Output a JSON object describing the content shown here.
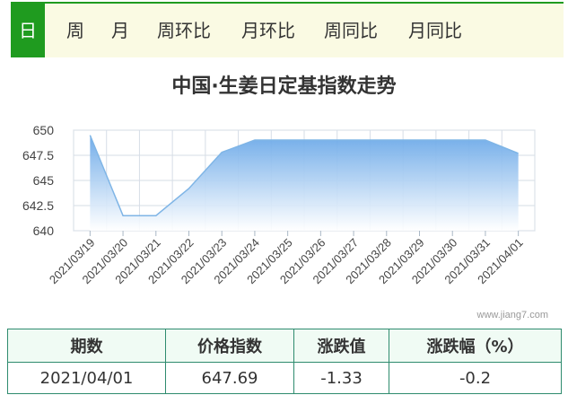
{
  "tabs": [
    {
      "label": "日",
      "active": true
    },
    {
      "label": "周"
    },
    {
      "label": "月"
    },
    {
      "label": "周环比"
    },
    {
      "label": "月环比"
    },
    {
      "label": "周同比"
    },
    {
      "label": "月同比"
    }
  ],
  "watermark": "www.jiang7.com",
  "table": {
    "headers": [
      "期数",
      "价格指数",
      "涨跌值",
      "涨跌幅（%）"
    ],
    "row": [
      "2021/04/01",
      "647.69",
      "-1.33",
      "-0.2"
    ]
  },
  "colors": {
    "accent": "#1f9b1f",
    "tab_bg": "#fafae3",
    "line": "#7fb5e6",
    "fill_top": "#6aa8e8",
    "table_border": "#2e8b6e"
  },
  "chart_data": {
    "type": "area",
    "title": "中国·生姜日定基指数走势",
    "xlabel": "",
    "ylabel": "",
    "x": [
      "2021/03/19",
      "2021/03/20",
      "2021/03/21",
      "2021/03/22",
      "2021/03/23",
      "2021/03/24",
      "2021/03/25",
      "2021/03/26",
      "2021/03/27",
      "2021/03/28",
      "2021/03/29",
      "2021/03/30",
      "2021/03/31",
      "2021/04/01"
    ],
    "values": [
      649.5,
      641.5,
      641.5,
      644.2,
      647.8,
      649.02,
      649.02,
      649.02,
      649.02,
      649.02,
      649.02,
      649.02,
      649.02,
      647.69
    ],
    "ylim": [
      640,
      650
    ],
    "yticks": [
      "640",
      "642.5",
      "645",
      "647.5",
      "650"
    ],
    "grid": true,
    "legend": "none"
  }
}
